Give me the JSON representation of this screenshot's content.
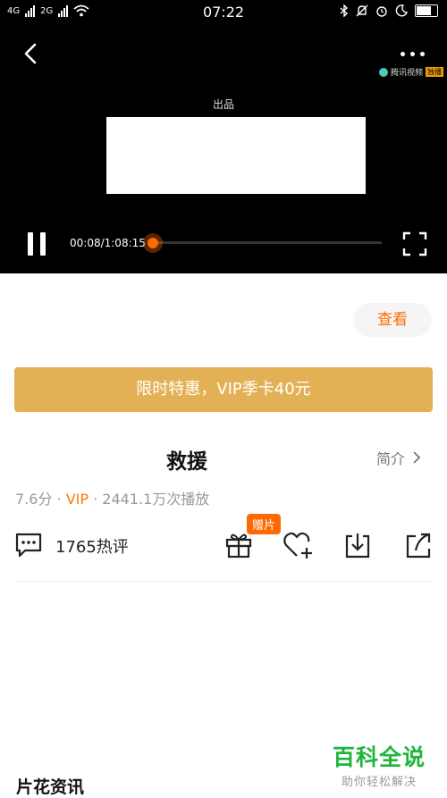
{
  "status_bar": {
    "time": "07:22",
    "net_left": "4G",
    "net_right": "2G"
  },
  "player": {
    "produced_label": "出品",
    "brand_label": "腾讯视频",
    "brand_tag": "独播",
    "time_display": "00:08/1:08:15",
    "progress_fraction": 0.002
  },
  "view_button": "查看",
  "promo_banner": "限时特惠，VIP季卡40元",
  "show": {
    "title": "救援",
    "intro_label": "简介",
    "score": "7.6分",
    "sep1": " · ",
    "vip": "VIP",
    "sep2": " · ",
    "plays": "2441.1万次播放"
  },
  "actions": {
    "comment_count": "1765热评",
    "gift_tag": "赠片"
  },
  "section_title": "片花资讯",
  "watermark": {
    "main": "百科全说",
    "sub": "助你轻松解决"
  },
  "colors": {
    "accent": "#ff6a00",
    "promo": "#e3b155",
    "watermark": "#1fb53b"
  }
}
